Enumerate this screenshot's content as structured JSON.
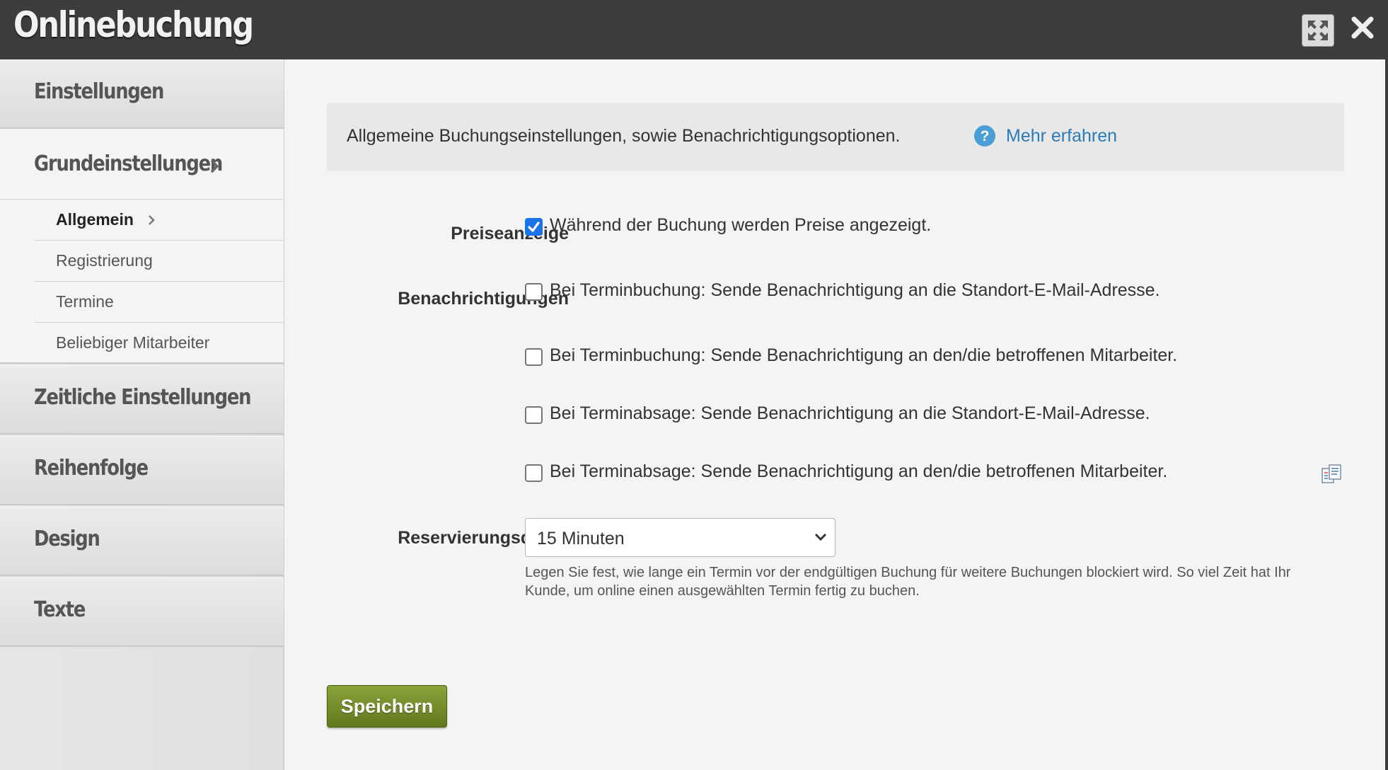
{
  "window": {
    "title": "Onlinebuchung",
    "expand_icon": "expand-arrows-icon",
    "close_icon": "close-x-icon"
  },
  "sidebar": {
    "sections": [
      {
        "label": "Einstellungen"
      },
      {
        "label": "Zeitliche Einstellungen"
      },
      {
        "label": "Reihenfolge"
      },
      {
        "label": "Design"
      },
      {
        "label": "Texte"
      }
    ],
    "subsection": {
      "label": "Grundeinstellungen"
    },
    "items": [
      {
        "label": "Allgemein",
        "active": true
      },
      {
        "label": "Registrierung"
      },
      {
        "label": "Termine"
      },
      {
        "label": "Beliebiger Mitarbeiter"
      }
    ]
  },
  "main": {
    "info": {
      "text": "Allgemeine Buchungseinstellungen, sowie Benachrichtigungsoptionen.",
      "help_icon": "question-circle-icon",
      "link": "Mehr erfahren"
    },
    "price_display": {
      "label": "Preiseanzeige",
      "option": {
        "text": "Während der Buchung werden Preise angezeigt.",
        "checked": true
      }
    },
    "notifications": {
      "label": "Benachrichtigungen",
      "options": [
        {
          "text": "Bei Terminbuchung: Sende Benachrichtigung an die Standort-E-Mail-Adresse.",
          "checked": false
        },
        {
          "text": "Bei Terminbuchung: Sende Benachrichtigung an den/die betroffenen Mitarbeiter.",
          "checked": false
        },
        {
          "text": "Bei Terminabsage: Sende Benachrichtigung an die Standort-E-Mail-Adresse.",
          "checked": false
        },
        {
          "text": "Bei Terminabsage: Sende Benachrichtigung an den/die betroffenen Mitarbeiter.",
          "checked": false
        }
      ]
    },
    "reservation": {
      "label": "Reservierungsdauer",
      "selected": "15 Minuten",
      "hint": "Legen Sie fest, wie lange ein Termin vor der endgültigen Buchung für weitere Buchungen blockiert wird. So viel Zeit hat Ihr Kunde, um online einen ausgewählten Termin fertig zu buchen."
    },
    "save_label": "Speichern"
  },
  "colors": {
    "titlebar": "#3d3d3d",
    "link": "#2b7bb9",
    "checkbox_checked": "#1a73e8",
    "save_button": "#6f8a27"
  }
}
